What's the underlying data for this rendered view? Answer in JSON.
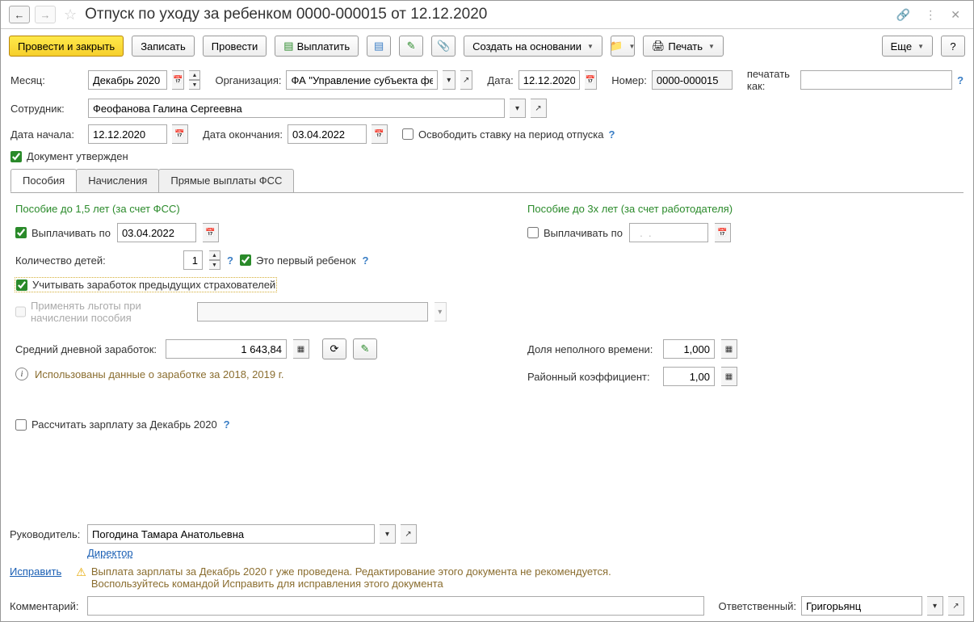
{
  "header": {
    "title": "Отпуск по уходу за ребенком 0000-000015 от 12.12.2020"
  },
  "toolbar": {
    "post_close": "Провести и закрыть",
    "write": "Записать",
    "post": "Провести",
    "pay": "Выплатить",
    "create_based": "Создать на основании",
    "print": "Печать",
    "more": "Еще",
    "help": "?"
  },
  "form": {
    "month_label": "Месяц:",
    "month_value": "Декабрь 2020",
    "org_label": "Организация:",
    "org_value": "ФА \"Управление субъекта федераци",
    "date_label": "Дата:",
    "date_value": "12.12.2020",
    "number_label": "Номер:",
    "number_value": "0000-000015",
    "print_as_label": "печатать как:",
    "employee_label": "Сотрудник:",
    "employee_value": "Феофанова Галина Сергеевна",
    "start_label": "Дата начала:",
    "start_value": "12.12.2020",
    "end_label": "Дата окончания:",
    "end_value": "03.04.2022",
    "release_rate": "Освободить ставку на период отпуска",
    "approved": "Документ утвержден"
  },
  "tabs": {
    "t1": "Пособия",
    "t2": "Начисления",
    "t3": "Прямые выплаты ФСС"
  },
  "benefits": {
    "fss_title": "Пособие до 1,5 лет (за счет ФСС)",
    "employer_title": "Пособие до 3х лет (за счет работодателя)",
    "pay_until": "Выплачивать по",
    "pay_until_date": "03.04.2022",
    "pay_until3_placeholder": "  .  .    ",
    "children_label": "Количество детей:",
    "children_value": "1",
    "first_child": "Это первый ребенок",
    "prev_insurers": "Учитывать заработок предыдущих страхователей",
    "apply_benefits": "Применять льготы при начислении пособия",
    "avg_daily_label": "Средний дневной заработок:",
    "avg_daily_value": "1 643,84",
    "part_time_label": "Доля неполного времени:",
    "part_time_value": "1,000",
    "district_label": "Районный коэффициент:",
    "district_value": "1,00",
    "years_info": "Использованы данные о заработке за  2018,  2019 г.",
    "calc_salary": "Рассчитать зарплату за Декабрь 2020"
  },
  "footer": {
    "manager_label": "Руководитель:",
    "manager_value": "Погодина Тамара Анатольевна",
    "manager_position": "Директор",
    "fix_link": "Исправить",
    "warning1": "Выплата зарплаты за Декабрь 2020 г уже проведена. Редактирование этого документа не рекомендуется.",
    "warning2": "Воспользуйтесь командой Исправить для исправления этого документа",
    "comment_label": "Комментарий:",
    "responsible_label": "Ответственный:",
    "responsible_value": "Григорьянц"
  }
}
